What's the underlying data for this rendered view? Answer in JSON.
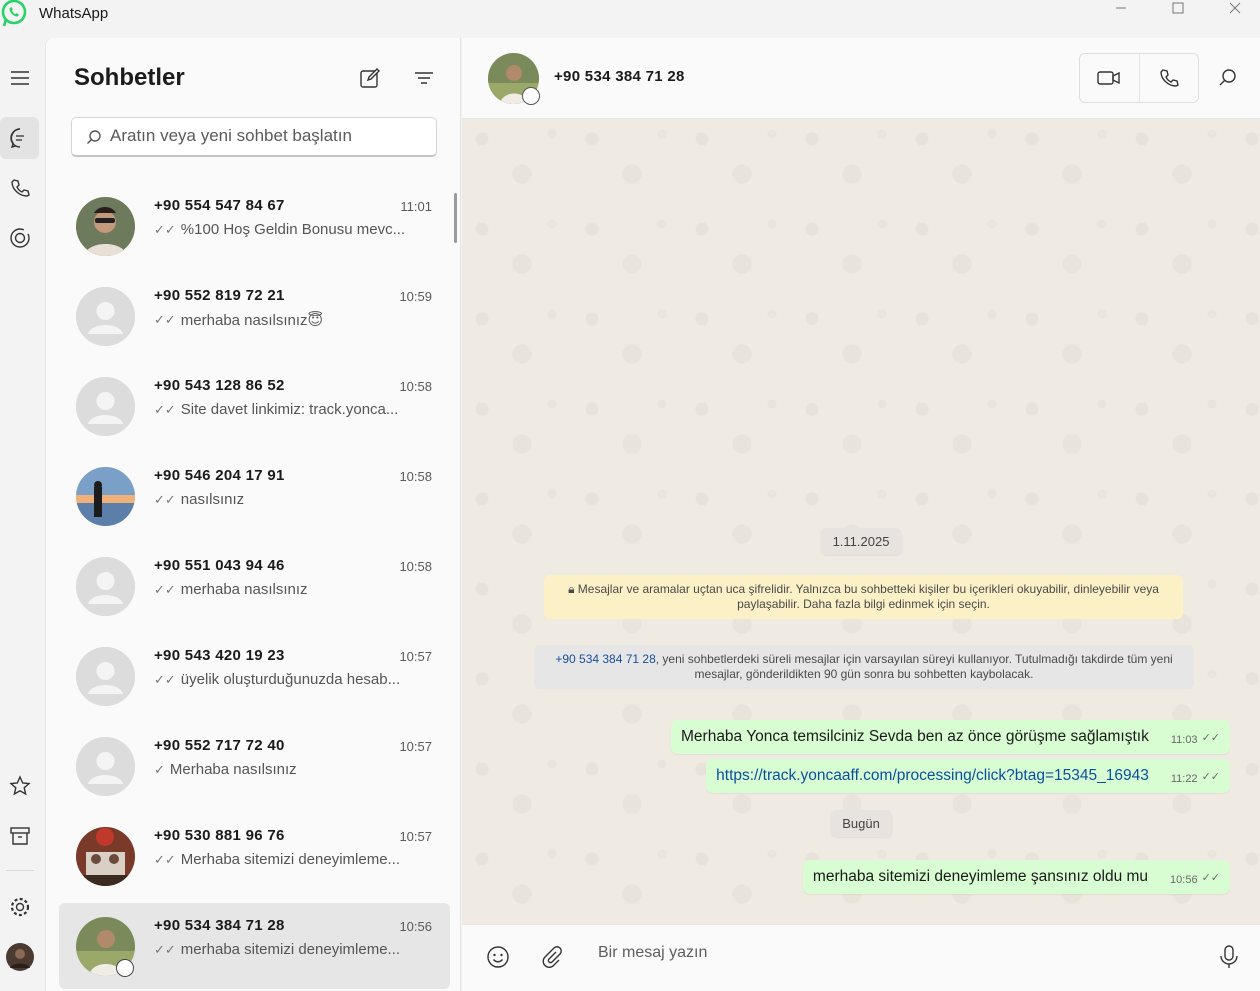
{
  "window": {
    "title": "WhatsApp"
  },
  "sidebar_list": {
    "title": "Sohbetler",
    "search_placeholder": "Aratın veya yeni sohbet başlatın"
  },
  "chats": [
    {
      "name": "+90 554 547 84 67",
      "time": "11:01",
      "ticks": "✓✓",
      "preview": "%100 Hoş Geldin Bonusu mevc...",
      "avatar": "photo-man-sunglasses"
    },
    {
      "name": "+90 552 819 72 21",
      "time": "10:59",
      "ticks": "✓✓",
      "preview": "merhaba nasılsınız😇",
      "avatar": "default"
    },
    {
      "name": "+90 543 128 86 52",
      "time": "10:58",
      "ticks": "✓✓",
      "preview": "Site davet linkimiz: track.yonca...",
      "avatar": "default"
    },
    {
      "name": "+90 546 204 17 91",
      "time": "10:58",
      "ticks": "✓✓",
      "preview": "nasılsınız",
      "avatar": "photo-sunset"
    },
    {
      "name": "+90 551 043 94 46",
      "time": "10:58",
      "ticks": "✓✓",
      "preview": "merhaba nasılsınız",
      "avatar": "default"
    },
    {
      "name": "+90 543 420 19 23",
      "time": "10:57",
      "ticks": "✓✓",
      "preview": "üyelik oluşturduğunuzda hesab...",
      "avatar": "default"
    },
    {
      "name": "+90 552 717 72 40",
      "time": "10:57",
      "ticks": "✓",
      "preview": "Merhaba nasılsınız",
      "avatar": "default"
    },
    {
      "name": "+90 530 881 96 76",
      "time": "10:57",
      "ticks": "✓✓",
      "preview": "Merhaba sitemizi deneyimleme...",
      "avatar": "photo-family"
    },
    {
      "name": "+90 534 384 71 28",
      "time": "10:56",
      "ticks": "✓✓",
      "preview": "merhaba sitemizi deneyimleme...",
      "avatar": "photo-person",
      "selected": true
    }
  ],
  "conversation": {
    "name": "+90 534 384 71 28",
    "date_1": "1.11.2025",
    "encryption_notice": "Mesajlar ve aramalar uçtan uca şifrelidir. Yalnızca bu sohbetteki kişiler bu içerikleri okuyabilir, dinleyebilir veya paylaşabilir. Daha fazla bilgi edinmek için seçin.",
    "timer_notice_contact": "+90 534 384 71 28",
    "timer_notice_text": ", yeni sohbetlerdeki süreli mesajlar için varsayılan süreyi kullanıyor. Tutulmadığı takdirde tüm yeni mesajlar, gönderildikten 90 gün sonra bu sohbetten kaybolacak.",
    "messages": [
      {
        "text": "Merhaba Yonca temsilciniz Sevda ben az önce görüşme sağlamıştık",
        "time": "11:03",
        "ticks": "✓✓"
      },
      {
        "text": "https://track.yoncaaff.com/processing/click?btag=15345_16943",
        "time": "11:22",
        "ticks": "✓✓",
        "link": true
      }
    ],
    "date_2": "Bugün",
    "messages_today": [
      {
        "text": "merhaba sitemizi deneyimleme şansınız oldu mu",
        "time": "10:56",
        "ticks": "✓✓"
      }
    ],
    "composer_placeholder": "Bir mesaj yazın"
  },
  "colors": {
    "outgoing_bubble": "#d9fdd3",
    "chat_bg": "#efeae2",
    "brand": "#25d366"
  }
}
